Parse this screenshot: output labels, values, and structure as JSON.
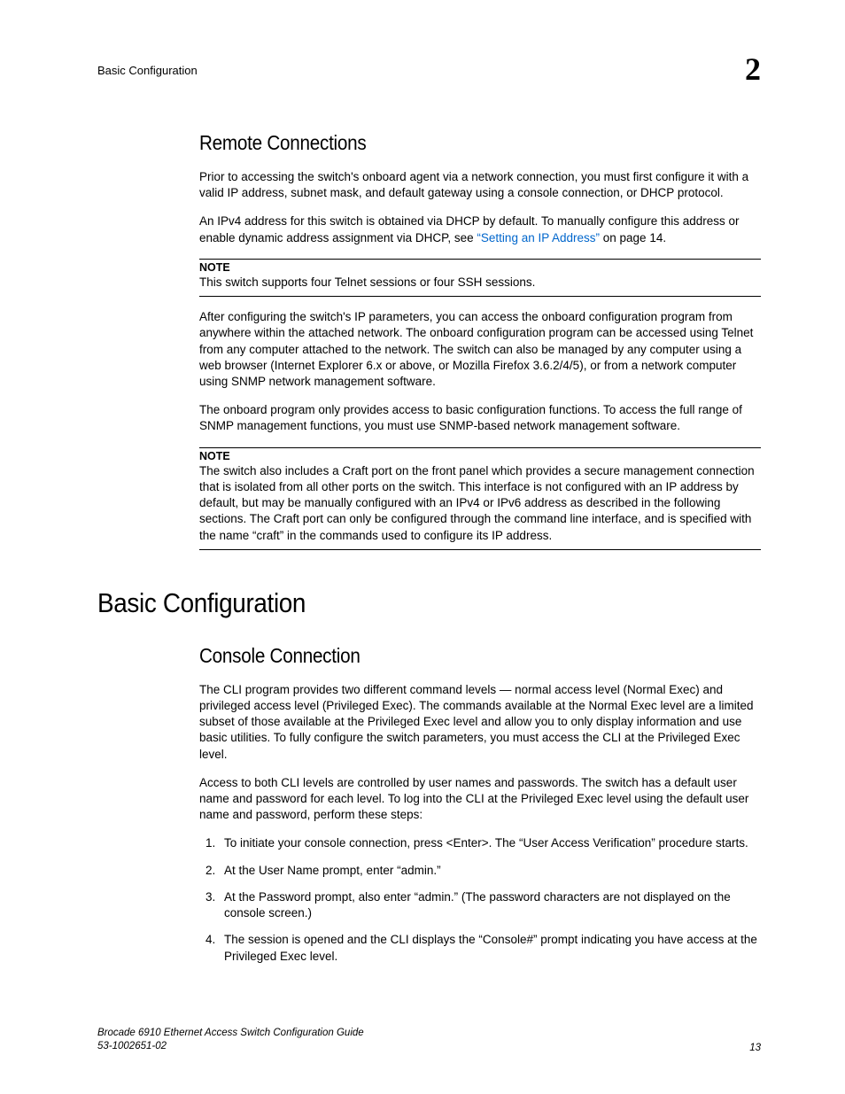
{
  "header": {
    "running_title": "Basic Configuration",
    "chapter_number": "2"
  },
  "sections": {
    "remote_connections": {
      "heading": "Remote Connections",
      "p1": "Prior to accessing the switch's onboard agent via a network connection, you must first configure it with a valid IP address, subnet mask, and default gateway using a console connection, or DHCP protocol.",
      "p2_a": "An IPv4 address for this switch is obtained via DHCP by default. To manually configure this address or enable dynamic address assignment via DHCP, see ",
      "p2_link": "“Setting an IP Address”",
      "p2_b": " on page 14.",
      "note1_label": "NOTE",
      "note1_text": "This switch supports four Telnet sessions or four SSH sessions.",
      "p3": "After configuring the switch's IP parameters, you can access the onboard configuration program from anywhere within the attached network. The onboard configuration program can be accessed using Telnet from any computer attached to the network. The switch can also be managed by any computer using a web browser (Internet Explorer 6.x or above, or Mozilla Firefox 3.6.2/4/5), or from a network computer using SNMP network management software.",
      "p4": "The onboard program only provides access to basic configuration functions. To access the full range of SNMP management functions, you must use SNMP-based network management software.",
      "note2_label": "NOTE",
      "note2_text": "The switch also includes a Craft port on the front panel which provides a secure management connection that is isolated from all other ports on the switch. This interface is not configured with an IP address by default, but may be manually configured with an IPv4 or IPv6 address as described in the following sections. The Craft port can only be configured through the command line interface, and is specified with the name “craft” in the commands used to configure its IP address."
    },
    "basic_configuration": {
      "heading": "Basic Configuration",
      "console_connection": {
        "heading": "Console Connection",
        "p1": "The CLI program provides two different command levels — normal access level (Normal Exec) and privileged access level (Privileged Exec). The commands available at the Normal Exec level are a limited subset of those available at the Privileged Exec level and allow you to only display information and use basic utilities. To fully configure the switch parameters, you must access the CLI at the Privileged Exec level.",
        "p2": "Access to both CLI levels are controlled by user names and passwords. The switch has a default user name and password for each level. To log into the CLI at the Privileged Exec level using the default user name and password, perform these steps:",
        "steps": [
          "To initiate your console connection, press <Enter>. The “User Access Verification” procedure starts.",
          "At the User Name prompt, enter “admin.”",
          "At the Password prompt, also enter “admin.” (The password characters are not displayed on the console screen.)",
          "The session is opened and the CLI displays the “Console#” prompt indicating you have access at the Privileged Exec level."
        ]
      }
    }
  },
  "footer": {
    "book_title": "Brocade 6910 Ethernet Access Switch Configuration Guide",
    "doc_number": "53-1002651-02",
    "page_number": "13"
  }
}
